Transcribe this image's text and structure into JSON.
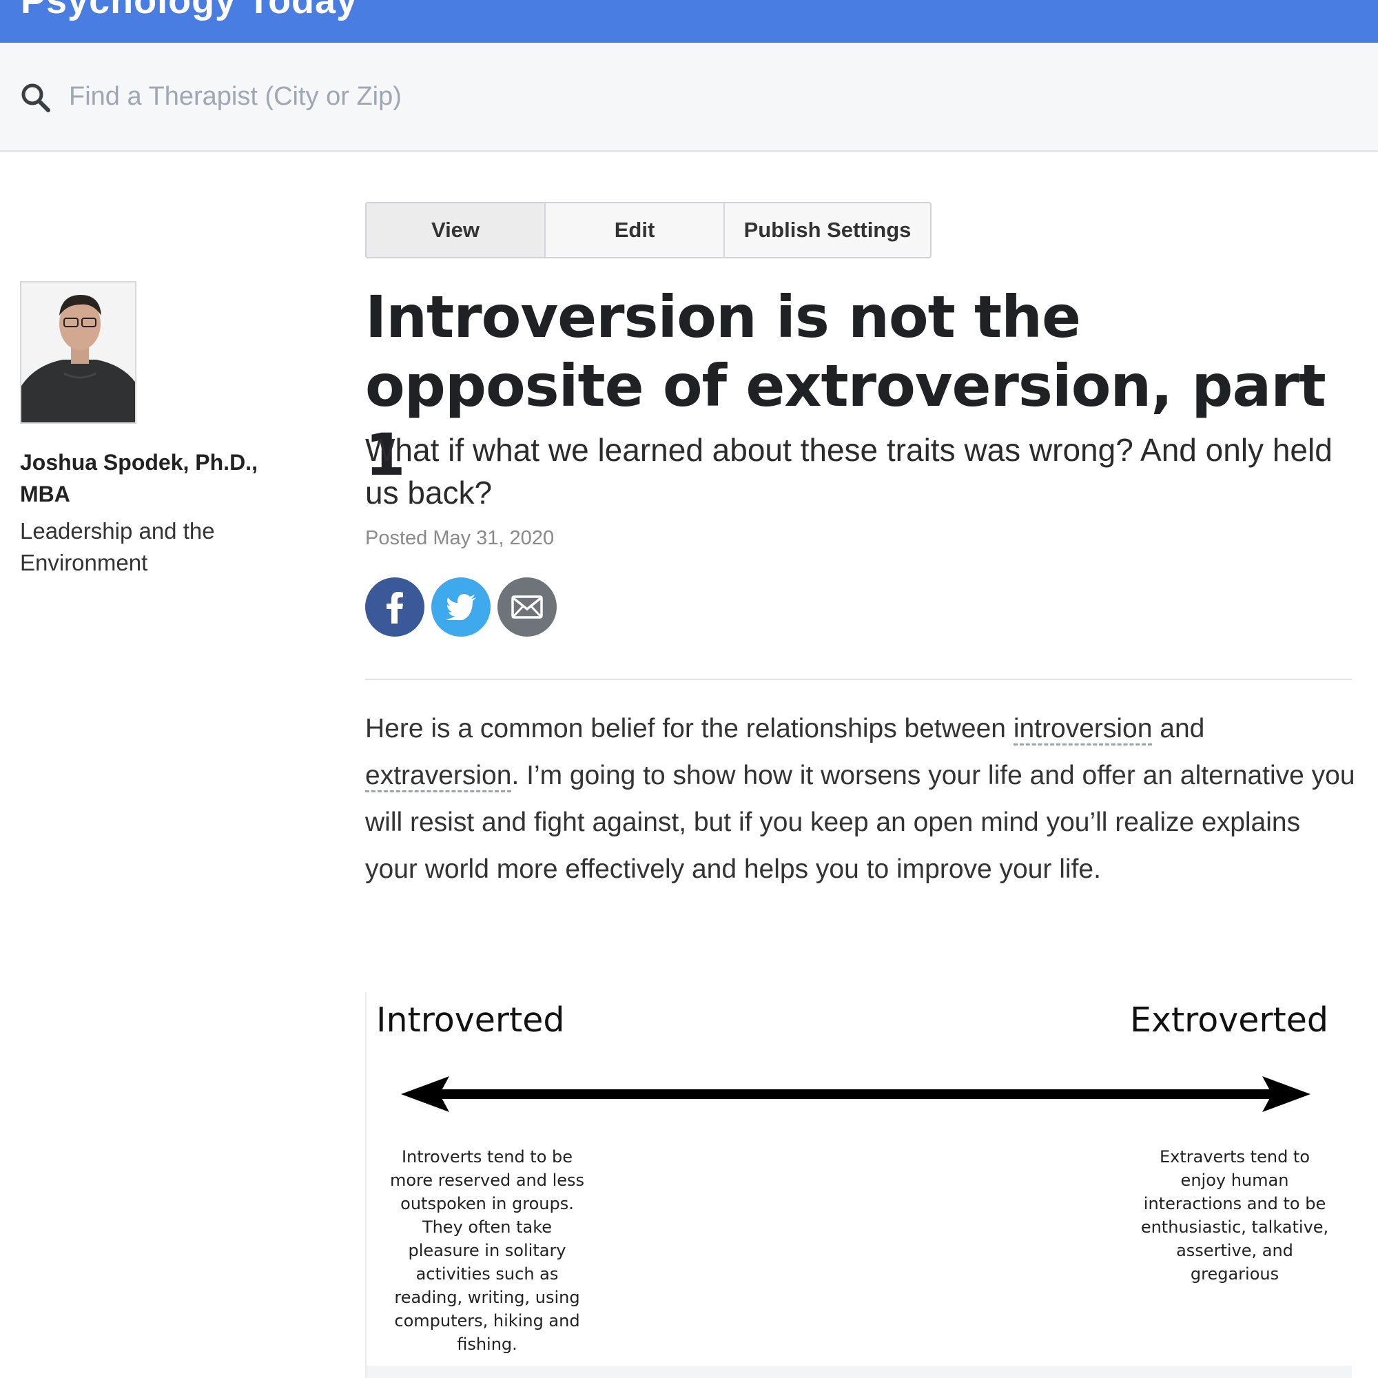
{
  "brand": {
    "name": "Psychology Today"
  },
  "search": {
    "placeholder": "Find a Therapist (City or Zip)"
  },
  "tabs": [
    {
      "label": "View",
      "active": true
    },
    {
      "label": "Edit",
      "active": false
    },
    {
      "label": "Publish Settings",
      "active": false
    }
  ],
  "author": {
    "name": "Joshua Spodek, Ph.D., MBA",
    "blog": "Leadership and the Environment"
  },
  "article": {
    "title": "Introversion is not the opposite of extroversion, part 1",
    "subtitle": "What if what we learned about these traits was wrong? And only held us back?",
    "posted": "Posted May 31, 2020",
    "body": {
      "part1": "Here is a common belief for the relationships between ",
      "term1": "introversion",
      "part2": " and ",
      "term2": "extraversion",
      "part3": ". I’m going to show how it worsens your life and offer an alternative you will resist and fight against, but if you keep an open mind you’ll realize explains your world more effectively and helps you to improve your life."
    }
  },
  "share": {
    "icons": [
      "facebook-icon",
      "twitter-icon",
      "email-icon"
    ],
    "colors": {
      "facebook": "#3b5998",
      "twitter": "#3ea9ec",
      "email": "#6f747a"
    }
  },
  "figure": {
    "left_label": "Introverted",
    "right_label": "Extroverted",
    "left_description": "Introverts tend to be more reserved and less outspoken in groups. They often take pleasure in solitary activities such as reading, writing, using computers, hiking and fishing.",
    "right_description": "Extraverts tend to enjoy human interactions and to be enthusiastic, talkative, assertive, and gregarious"
  },
  "colors": {
    "topbar": "#4a7de2",
    "searchbar": "#f6f7f9"
  }
}
